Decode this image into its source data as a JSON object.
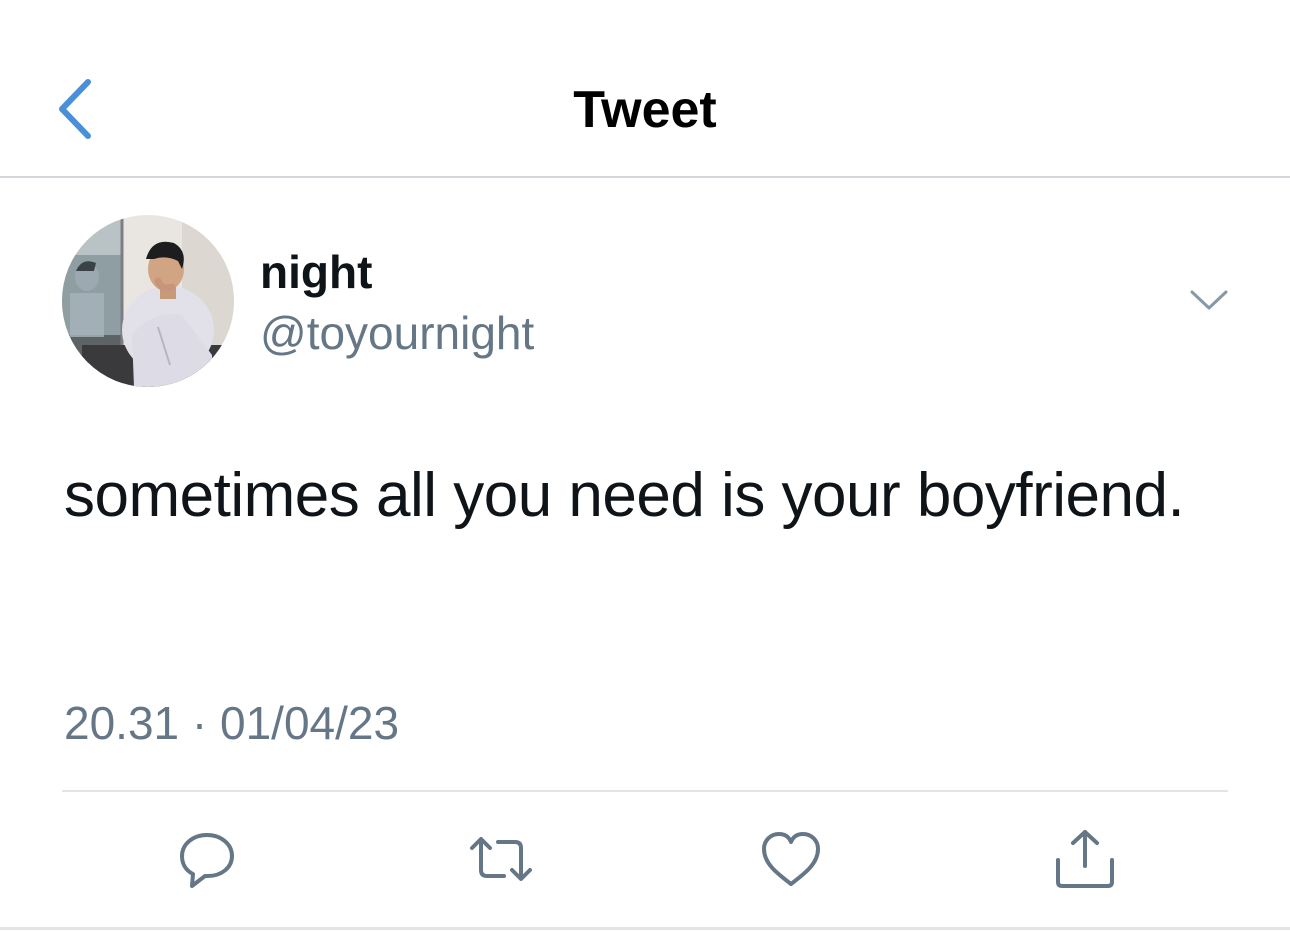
{
  "nav": {
    "title": "Tweet",
    "back_icon": "chevron-left-icon"
  },
  "author": {
    "display_name": "night",
    "handle": "@toyournight",
    "avatar": "profile-photo"
  },
  "tweet": {
    "text": "sometimes all you need is your boyfriend.",
    "timestamp": "20.31 · 01/04/23"
  },
  "actions": [
    {
      "icon": "reply-icon"
    },
    {
      "icon": "retweet-icon"
    },
    {
      "icon": "like-icon"
    },
    {
      "icon": "share-icon"
    }
  ],
  "colors": {
    "accent": "#1d9bf0",
    "text": "#0f1419",
    "secondary_text": "#657786",
    "divider": "#e1e5e8"
  }
}
